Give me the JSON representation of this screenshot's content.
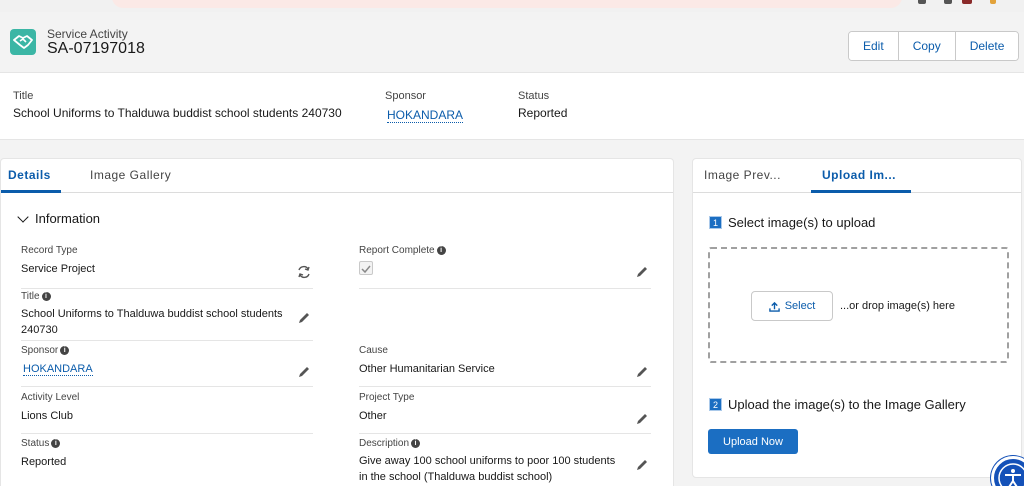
{
  "header": {
    "object_type": "Service Activity",
    "record_name": "SA-07197018",
    "buttons": {
      "edit": "Edit",
      "copy": "Copy",
      "delete": "Delete"
    },
    "icon": "handshake-icon",
    "icon_color": "#3bb6a5"
  },
  "highlights": {
    "title_label": "Title",
    "title_value": "School Uniforms to Thalduwa buddist school students 240730",
    "sponsor_label": "Sponsor",
    "sponsor_value": "HOKANDARA",
    "status_label": "Status",
    "status_value": "Reported"
  },
  "left_tabs": {
    "details": "Details",
    "image_gallery": "Image Gallery"
  },
  "section": {
    "title": "Information"
  },
  "fields": {
    "record_type": {
      "label": "Record Type",
      "value": "Service Project"
    },
    "report_complete": {
      "label": "Report Complete",
      "checked": true
    },
    "title": {
      "label": "Title",
      "value_line1": "School Uniforms to Thalduwa buddist school students",
      "value_line2": "240730"
    },
    "sponsor": {
      "label": "Sponsor",
      "value": "HOKANDARA"
    },
    "cause": {
      "label": "Cause",
      "value": "Other Humanitarian Service"
    },
    "activity_level": {
      "label": "Activity Level",
      "value": "Lions Club"
    },
    "project_type": {
      "label": "Project Type",
      "value": "Other"
    },
    "status": {
      "label": "Status",
      "value": "Reported"
    },
    "description": {
      "label": "Description",
      "value_line1": "Give away 100 school uniforms to poor 100 students",
      "value_line2": "in the school (Thalduwa buddist school)"
    }
  },
  "right_tabs": {
    "image_preview": "Image Prev...",
    "upload_images": "Upload Im..."
  },
  "upload": {
    "step1_num": "1",
    "step1_text": "Select image(s) to upload",
    "select_label": "Select",
    "drop_text": "...or drop image(s) here",
    "step2_num": "2",
    "step2_text": "Upload the image(s) to the Image Gallery",
    "upload_now_label": "Upload Now"
  },
  "colors": {
    "brand": "#0b5cab",
    "button_blue": "#1b6ec2"
  }
}
